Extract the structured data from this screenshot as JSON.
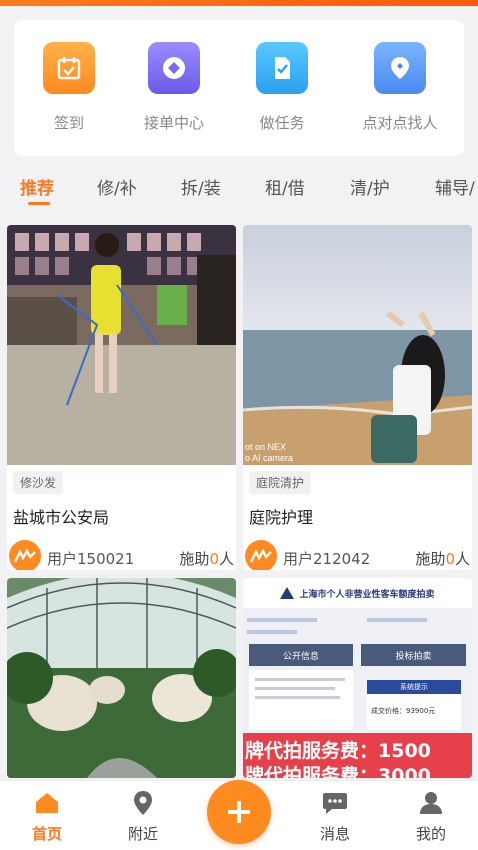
{
  "quick_actions": [
    {
      "label": "签到",
      "icon": "calendar-check-icon",
      "color": "#ff9a2e"
    },
    {
      "label": "接单中心",
      "icon": "diamond-icon",
      "color": "#7a6cf0"
    },
    {
      "label": "做任务",
      "icon": "task-check-icon",
      "color": "#3ab4f2"
    },
    {
      "label": "点对点找人",
      "icon": "location-pin-icon",
      "color": "#5a9bf6"
    }
  ],
  "tabs": [
    "推荐",
    "修/补",
    "拆/装",
    "租/借",
    "清/护",
    "辅导/"
  ],
  "cards": [
    {
      "tag": "修沙发",
      "title": "盐城市公安局",
      "user": "用户150021",
      "help_prefix": "施助",
      "help_count": "0",
      "help_suffix": "人",
      "watermark": ""
    },
    {
      "tag": "庭院清护",
      "title": "庭院护理",
      "user": "用户212042",
      "help_prefix": "施助",
      "help_count": "0",
      "help_suffix": "人",
      "watermark": "ot on NEX\no AI camera"
    },
    {
      "banner_title": "上海市个人非营业性客车额度拍卖",
      "panel_left": "公开信息",
      "panel_right": "投标拍卖",
      "notice": "系统提示",
      "deal_price": "成交价格：93900元",
      "promo1": "牌代拍服务费：1500",
      "promo2": "牌代拍服务费：3000"
    }
  ],
  "nav": [
    {
      "label": "首页",
      "icon": "home-icon",
      "active": true
    },
    {
      "label": "附近",
      "icon": "map-pin-icon",
      "active": false
    },
    {
      "label": "消息",
      "icon": "message-icon",
      "active": false
    },
    {
      "label": "我的",
      "icon": "user-icon",
      "active": false
    }
  ],
  "colors": {
    "accent": "#ff7a1f"
  }
}
